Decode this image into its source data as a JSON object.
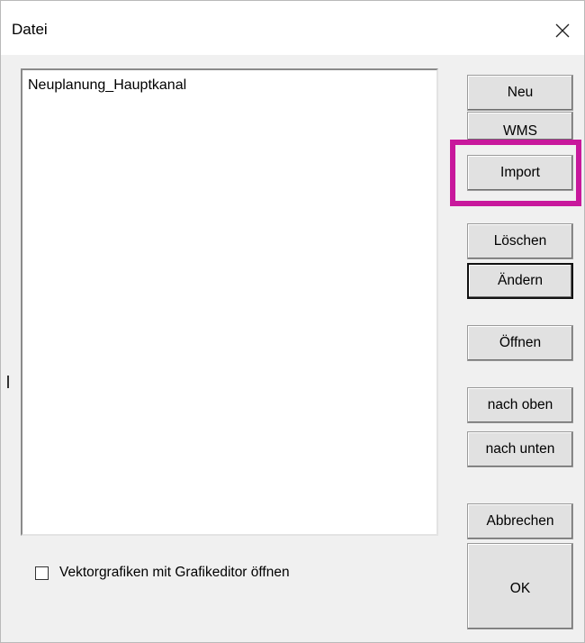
{
  "window": {
    "title": "Datei"
  },
  "files": {
    "items": [
      "Neuplanung_Hauptkanal"
    ]
  },
  "buttons": {
    "new": "Neu",
    "wms": "WMS",
    "import": "Import",
    "delete": "Löschen",
    "change": "Ändern",
    "open": "Öffnen",
    "move_up": "nach oben",
    "move_down": "nach unten",
    "cancel": "Abbrechen",
    "ok": "OK"
  },
  "options": {
    "vector_editor_label": "Vektorgrafiken mit Grafikeditor öffnen",
    "vector_editor_checked": false
  },
  "icons": {
    "close": "close-icon"
  },
  "colors": {
    "highlight": "#c8189c",
    "dialog_bg": "#f0f0f0"
  }
}
